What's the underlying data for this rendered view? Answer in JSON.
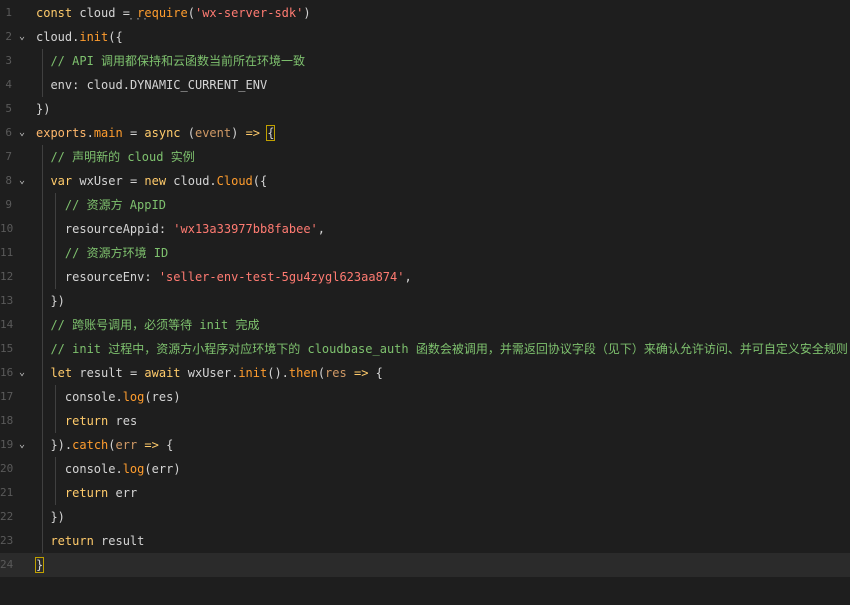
{
  "editor": {
    "lines": [
      {
        "n": "1",
        "fold": false,
        "segs": [
          [
            "kw",
            "const"
          ],
          [
            "id",
            " cloud "
          ],
          [
            "punc",
            "= "
          ],
          [
            "fn",
            "require"
          ],
          [
            "punc",
            "("
          ],
          [
            "str",
            "'wx-server-sdk'"
          ],
          [
            "punc",
            ")"
          ]
        ]
      },
      {
        "n": "2",
        "fold": true,
        "segs": [
          [
            "id",
            "cloud"
          ],
          [
            "punc",
            "."
          ],
          [
            "fn",
            "init"
          ],
          [
            "punc",
            "({"
          ]
        ]
      },
      {
        "n": "3",
        "fold": false,
        "indent": 1,
        "segs": [
          [
            "cm",
            "// API 调用都保持和云函数当前所在环境一致"
          ]
        ]
      },
      {
        "n": "4",
        "fold": false,
        "indent": 1,
        "segs": [
          [
            "id",
            "env: cloud."
          ],
          [
            "id",
            "DYNAMIC_CURRENT_ENV"
          ]
        ]
      },
      {
        "n": "5",
        "fold": false,
        "segs": [
          [
            "punc",
            "})"
          ]
        ]
      },
      {
        "n": "6",
        "fold": true,
        "segs": [
          [
            "ob",
            "exports"
          ],
          [
            "punc",
            "."
          ],
          [
            "fn",
            "main"
          ],
          [
            "punc",
            " = "
          ],
          [
            "kw",
            "async"
          ],
          [
            "punc",
            " ("
          ],
          [
            "pm",
            "event"
          ],
          [
            "punc",
            ") "
          ],
          [
            "kw",
            "=>"
          ],
          [
            "punc",
            " "
          ],
          [
            "punc",
            "{"
          ]
        ]
      },
      {
        "n": "7",
        "fold": false,
        "indent": 1,
        "segs": [
          [
            "cm",
            "// 声明新的 cloud 实例"
          ]
        ]
      },
      {
        "n": "8",
        "fold": true,
        "indent": 1,
        "segs": [
          [
            "kw",
            "var"
          ],
          [
            "id",
            " wxUser "
          ],
          [
            "punc",
            "= "
          ],
          [
            "kw",
            "new"
          ],
          [
            "id",
            " cloud."
          ],
          [
            "fn",
            "Cloud"
          ],
          [
            "punc",
            "({"
          ]
        ]
      },
      {
        "n": "9",
        "fold": false,
        "indent": 2,
        "segs": [
          [
            "cm",
            "// 资源方 AppID"
          ]
        ]
      },
      {
        "n": "10",
        "fold": false,
        "indent": 2,
        "segs": [
          [
            "id",
            "resourceAppid: "
          ],
          [
            "str",
            "'wx13a33977bb8fabee'"
          ],
          [
            "punc",
            ","
          ]
        ]
      },
      {
        "n": "11",
        "fold": false,
        "indent": 2,
        "segs": [
          [
            "cm",
            "// 资源方环境 ID"
          ]
        ]
      },
      {
        "n": "12",
        "fold": false,
        "indent": 2,
        "segs": [
          [
            "id",
            "resourceEnv: "
          ],
          [
            "str",
            "'seller-env-test-5gu4zygl623aa874'"
          ],
          [
            "punc",
            ","
          ]
        ]
      },
      {
        "n": "13",
        "fold": false,
        "indent": 1,
        "segs": [
          [
            "punc",
            "})"
          ]
        ]
      },
      {
        "n": "14",
        "fold": false,
        "indent": 1,
        "segs": [
          [
            "cm",
            "// 跨账号调用，必须等待 init 完成"
          ]
        ]
      },
      {
        "n": "15",
        "fold": false,
        "indent": 1,
        "segs": [
          [
            "cm",
            "// init 过程中，资源方小程序对应环境下的 cloudbase_auth 函数会被调用，并需返回协议字段（见下）来确认允许访问、并可自定义安全规则"
          ]
        ]
      },
      {
        "n": "16",
        "fold": true,
        "indent": 1,
        "segs": [
          [
            "kw",
            "let"
          ],
          [
            "id",
            " result "
          ],
          [
            "punc",
            "= "
          ],
          [
            "kw",
            "await"
          ],
          [
            "id",
            " wxUser."
          ],
          [
            "fn",
            "init"
          ],
          [
            "punc",
            "()."
          ],
          [
            "fn",
            "then"
          ],
          [
            "punc",
            "("
          ],
          [
            "pm",
            "res"
          ],
          [
            "punc",
            " "
          ],
          [
            "kw",
            "=>"
          ],
          [
            "punc",
            " {"
          ]
        ]
      },
      {
        "n": "17",
        "fold": false,
        "indent": 2,
        "segs": [
          [
            "id",
            "console."
          ],
          [
            "fn",
            "log"
          ],
          [
            "punc",
            "("
          ],
          [
            "id",
            "res"
          ],
          [
            "punc",
            ")"
          ]
        ]
      },
      {
        "n": "18",
        "fold": false,
        "indent": 2,
        "segs": [
          [
            "kw",
            "return"
          ],
          [
            "id",
            " res"
          ]
        ]
      },
      {
        "n": "19",
        "fold": true,
        "indent": 1,
        "segs": [
          [
            "punc",
            "})."
          ],
          [
            "fn",
            "catch"
          ],
          [
            "punc",
            "("
          ],
          [
            "pm",
            "err"
          ],
          [
            "punc",
            " "
          ],
          [
            "kw",
            "=>"
          ],
          [
            "punc",
            " {"
          ]
        ]
      },
      {
        "n": "20",
        "fold": false,
        "indent": 2,
        "segs": [
          [
            "id",
            "console."
          ],
          [
            "fn",
            "log"
          ],
          [
            "punc",
            "("
          ],
          [
            "id",
            "err"
          ],
          [
            "punc",
            ")"
          ]
        ]
      },
      {
        "n": "21",
        "fold": false,
        "indent": 2,
        "segs": [
          [
            "kw",
            "return"
          ],
          [
            "id",
            " err"
          ]
        ]
      },
      {
        "n": "22",
        "fold": false,
        "indent": 1,
        "segs": [
          [
            "punc",
            "})"
          ]
        ]
      },
      {
        "n": "23",
        "fold": false,
        "indent": 1,
        "segs": [
          [
            "kw",
            "return"
          ],
          [
            "id",
            " result"
          ]
        ]
      },
      {
        "n": "24",
        "fold": false,
        "current": true,
        "segs": [
          [
            "punc",
            "}"
          ]
        ]
      }
    ],
    "fold_glyph": "⌄",
    "ellipsis": "···"
  }
}
